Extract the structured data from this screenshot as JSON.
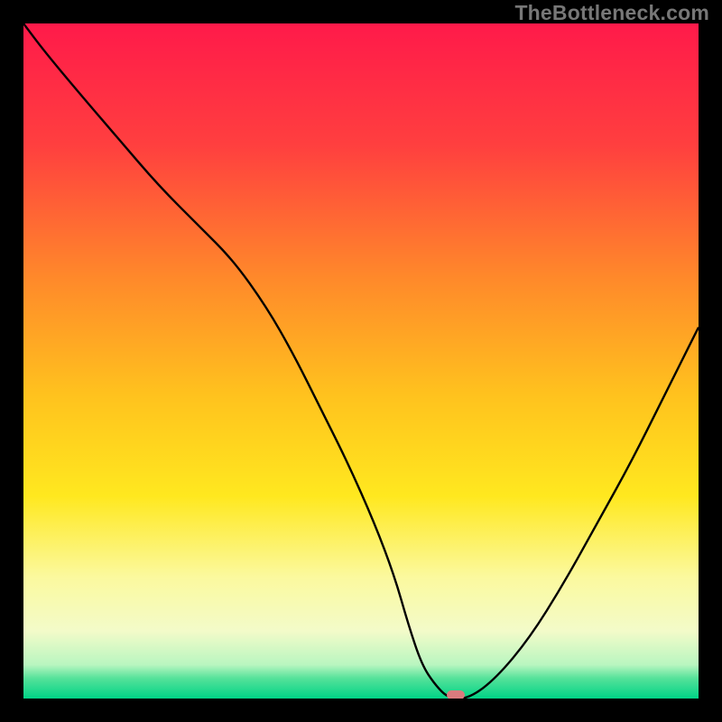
{
  "watermark": "TheBottleneck.com",
  "marker_color": "#da7b7e",
  "chart_data": {
    "type": "line",
    "title": "",
    "xlabel": "",
    "ylabel": "",
    "xlim": [
      0,
      100
    ],
    "ylim": [
      0,
      100
    ],
    "gradient_stops": [
      {
        "offset": 0,
        "color": "#ff1a4a"
      },
      {
        "offset": 18,
        "color": "#ff3f3f"
      },
      {
        "offset": 38,
        "color": "#ff8a2a"
      },
      {
        "offset": 55,
        "color": "#ffc21e"
      },
      {
        "offset": 70,
        "color": "#ffe81f"
      },
      {
        "offset": 82,
        "color": "#fbf99e"
      },
      {
        "offset": 90,
        "color": "#f3fbc9"
      },
      {
        "offset": 95,
        "color": "#b9f6c0"
      },
      {
        "offset": 97,
        "color": "#55e29a"
      },
      {
        "offset": 100,
        "color": "#00d386"
      }
    ],
    "series": [
      {
        "name": "bottleneck-curve",
        "x": [
          0,
          3,
          8,
          14,
          20,
          26,
          31,
          36,
          40,
          44,
          48,
          52,
          55,
          57,
          59,
          61,
          63,
          66,
          70,
          75,
          80,
          85,
          90,
          95,
          100
        ],
        "y": [
          100,
          96,
          90,
          83,
          76,
          70,
          65,
          58,
          51,
          43,
          35,
          26,
          18,
          11,
          5,
          2,
          0,
          0,
          3,
          9,
          17,
          26,
          35,
          45,
          55
        ]
      }
    ],
    "flat_min": {
      "x_start": 61,
      "x_end": 66
    },
    "marker": {
      "x": 64,
      "y": 0
    }
  }
}
